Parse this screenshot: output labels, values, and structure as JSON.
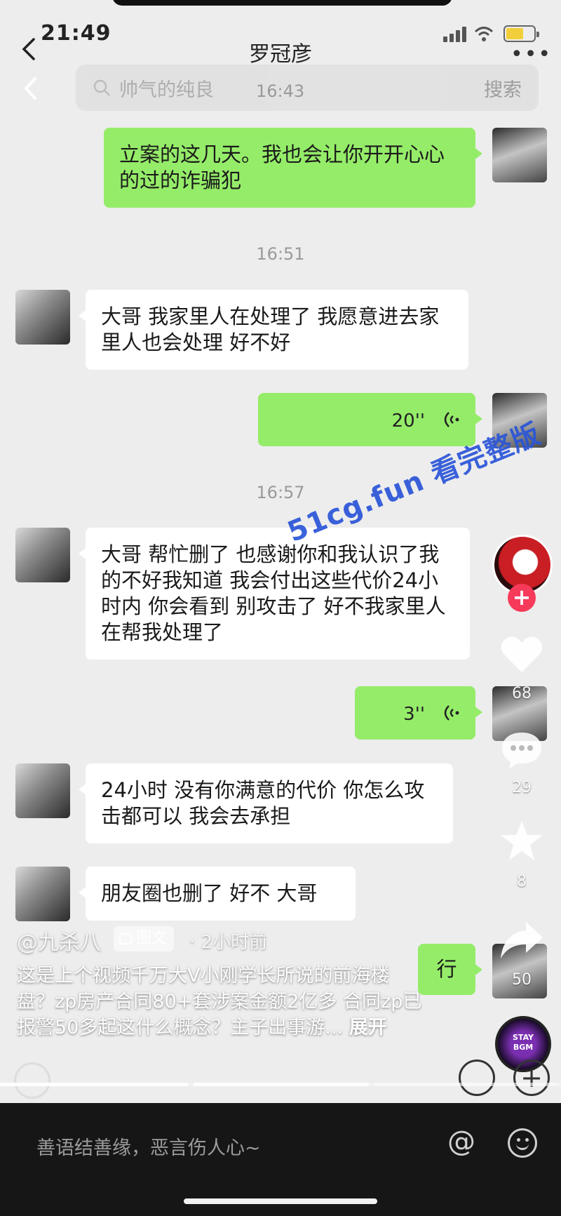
{
  "status_bar": {
    "time": "21:49"
  },
  "chat_header": {
    "title": "罗冠彦"
  },
  "search": {
    "placeholder": "帅气的纯良",
    "button": "搜索"
  },
  "overlay_timestamp": "16:43",
  "messages": {
    "m1": {
      "from": "me",
      "text": "立案的这几天。我也会让你开开心心的过的诈骗犯"
    },
    "ts2": "16:51",
    "m2": {
      "from": "them",
      "text": "大哥 我家里人在处理了 我愿意进去家里人也会处理 好不好"
    },
    "m3": {
      "from": "me",
      "type": "voice",
      "duration": "20''"
    },
    "ts3": "16:57",
    "m4": {
      "from": "them",
      "text": "大哥 帮忙删了 也感谢你和我认识了我的不好我知道 我会付出这些代价24小时内 你会看到 别攻击了 好不我家里人 在帮我处理了"
    },
    "m5": {
      "from": "me",
      "type": "voice",
      "duration": "3''"
    },
    "m6": {
      "from": "them",
      "text": "24小时 没有你满意的代价 你怎么攻击都可以 我会去承担"
    },
    "m7": {
      "from": "them",
      "text": "朋友圈也删了 好不 大哥"
    },
    "m8": {
      "from": "me",
      "text": "行"
    }
  },
  "watermark": "51cg.fun 看完整版",
  "rail": {
    "likes": "68",
    "comments": "29",
    "favorites": "8",
    "shares": "50",
    "music_label_1": "STAY",
    "music_label_2": "BGM"
  },
  "caption": {
    "user": "@九杀八",
    "tag": "图文",
    "time": "· 2小时前",
    "text": "这是上个视频千万大V小刚学长所说的前海楼盘？zp房产合同80+套涉案金额2亿多 合同zp已报警50多起这什么概念？主子出事游...",
    "expand": "展开"
  },
  "comment_bar": {
    "placeholder": "善语结善缘，恶言伤人心~"
  },
  "colors": {
    "bubble_me": "#95ec69",
    "bubble_them": "#ffffff",
    "watermark": "#2a55d8",
    "follow_plus": "#f73a5a"
  }
}
